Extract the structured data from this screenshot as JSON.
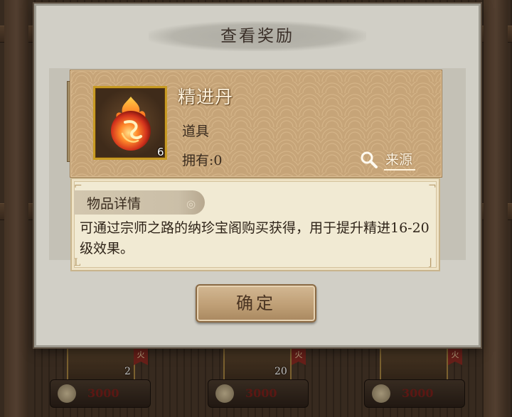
{
  "background": {
    "slots": [
      {
        "count": "2",
        "tag": "火",
        "price": "3000"
      },
      {
        "count": "20",
        "tag": "火",
        "price": "3000"
      },
      {
        "count": "",
        "tag": "火",
        "price": "3000"
      }
    ]
  },
  "dialog": {
    "title": "查看奖励",
    "confirm_label": "确定"
  },
  "item": {
    "name": "精进丹",
    "type": "道具",
    "owned": "拥有:0",
    "quantity": "6",
    "source_label": "来源",
    "icon": "fire-pill-icon"
  },
  "details": {
    "label": "物品详情",
    "text": "可通过宗师之路的纳珍宝阁购买获得，用于提升精进16-20级效果。"
  },
  "colors": {
    "card_bg": "#c6a478",
    "icon_frame": "#c89b23",
    "dialog_bg": "#d1cfc6"
  }
}
